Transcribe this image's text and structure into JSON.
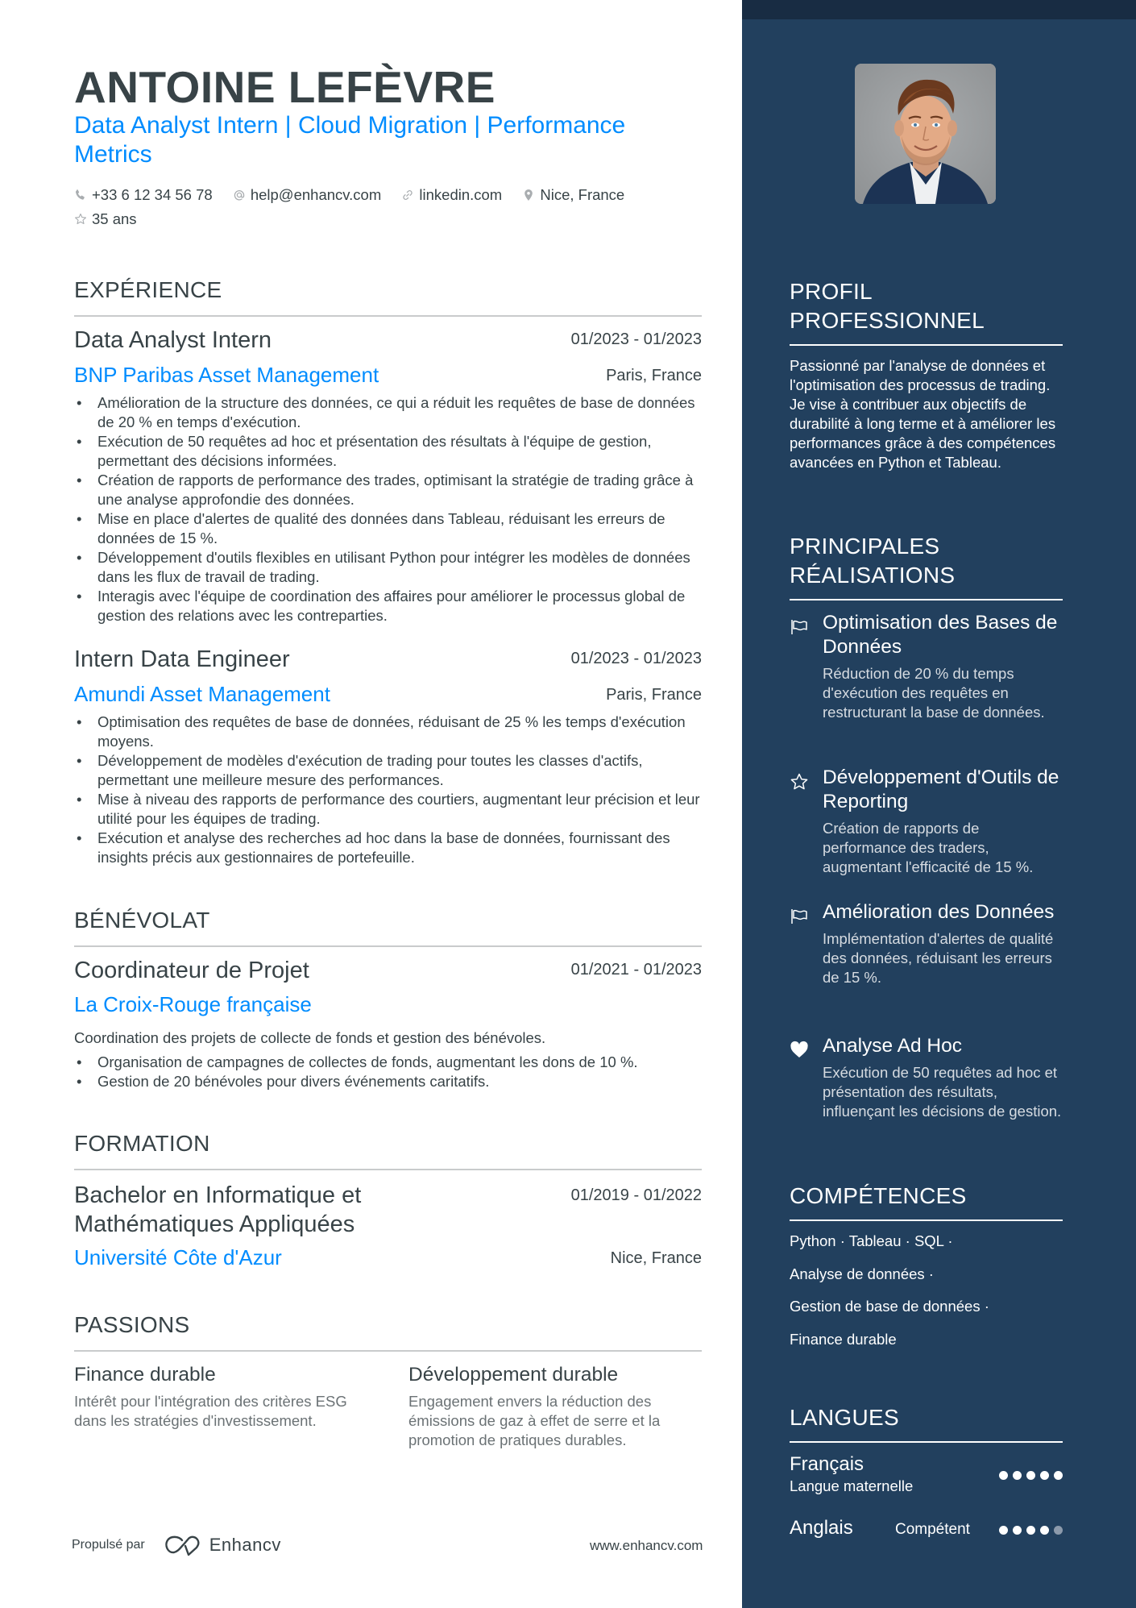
{
  "header": {
    "name": "ANTOINE LEFÈVRE",
    "subtitle": "Data Analyst Intern | Cloud Migration | Performance Metrics",
    "contacts": [
      {
        "icon": "phone-icon",
        "text": "+33 6 12 34 56 78"
      },
      {
        "icon": "at-icon",
        "text": "help@enhancv.com"
      },
      {
        "icon": "link-icon",
        "text": "linkedin.com"
      },
      {
        "icon": "location-pin-icon",
        "text": "Nice, France"
      },
      {
        "icon": "star-icon",
        "text": "35 ans"
      }
    ]
  },
  "experience": {
    "title": "EXPÉRIENCE",
    "entries": [
      {
        "role": "Data Analyst Intern",
        "dates": "01/2023 - 01/2023",
        "company": "BNP Paribas Asset Management",
        "location": "Paris, France",
        "bullets": [
          "Amélioration de la structure des données, ce qui a réduit les requêtes de base de données de 20 % en temps d'exécution.",
          "Exécution de 50 requêtes ad hoc et présentation des résultats à l'équipe de gestion, permettant des décisions informées.",
          "Création de rapports de performance des trades, optimisant la stratégie de trading grâce à une analyse approfondie des données.",
          "Mise en place d'alertes de qualité des données dans Tableau, réduisant les erreurs de données de 15 %.",
          "Développement d'outils flexibles en utilisant Python pour intégrer les modèles de données dans les flux de travail de trading.",
          "Interagis avec l'équipe de coordination des affaires pour améliorer le processus global de gestion des relations avec les contreparties."
        ]
      },
      {
        "role": "Intern Data Engineer",
        "dates": "01/2023 - 01/2023",
        "company": "Amundi Asset Management",
        "location": "Paris, France",
        "bullets": [
          "Optimisation des requêtes de base de données, réduisant de 25 % les temps d'exécution moyens.",
          "Développement de modèles d'exécution de trading pour toutes les classes d'actifs, permettant une meilleure mesure des performances.",
          "Mise à niveau des rapports de performance des courtiers, augmentant leur précision et leur utilité pour les équipes de trading.",
          "Exécution et analyse des recherches ad hoc dans la base de données, fournissant des insights précis aux gestionnaires de portefeuille."
        ]
      }
    ]
  },
  "volunteering": {
    "title": "BÉNÉVOLAT",
    "role": "Coordinateur de Projet",
    "dates": "01/2021 - 01/2023",
    "organization": "La Croix-Rouge française",
    "description": "Coordination des projets de collecte de fonds et gestion des bénévoles.",
    "bullets": [
      "Organisation de campagnes de collectes de fonds, augmentant les dons de 10 %.",
      "Gestion de 20 bénévoles pour divers événements caritatifs."
    ]
  },
  "education": {
    "title": "FORMATION",
    "degree": "Bachelor en Informatique et Mathématiques Appliquées",
    "dates": "01/2019 - 01/2022",
    "school": "Université Côte d'Azur",
    "location": "Nice, France"
  },
  "passions": {
    "title": "PASSIONS",
    "items": [
      {
        "title": "Finance durable",
        "description": "Intérêt pour l'intégration des critères ESG dans les stratégies d'investissement."
      },
      {
        "title": "Développement durable",
        "description": "Engagement envers la réduction des émissions de gaz à effet de serre et la promotion de pratiques durables."
      }
    ]
  },
  "footer": {
    "powered_by": "Propulsé par",
    "brand": "Enhancv",
    "website": "www.enhancv.com"
  },
  "sidebar": {
    "photo_alt": "Portrait of Antoine Lefèvre",
    "profile": {
      "title": "PROFIL PROFESSIONNEL",
      "text": "Passionné par l'analyse de données et l'optimisation des processus de trading. Je vise à contribuer aux objectifs de durabilité à long terme et à améliorer les performances grâce à des compétences avancées en Python et Tableau."
    },
    "achievements": {
      "title": "PRINCIPALES RÉALISATIONS",
      "items": [
        {
          "icon": "flag-icon",
          "title": "Optimisation des Bases de Données",
          "description": "Réduction de 20 % du temps d'exécution des requêtes en restructurant la base de données."
        },
        {
          "icon": "star-icon",
          "title": "Développement d'Outils de Reporting",
          "description": "Création de rapports de performance des traders, augmentant l'efficacité de 15 %."
        },
        {
          "icon": "flag-icon",
          "title": "Amélioration des Données",
          "description": "Implémentation d'alertes de qualité des données, réduisant les erreurs de 15 %."
        },
        {
          "icon": "heart-icon",
          "title": "Analyse Ad Hoc",
          "description": "Exécution de 50 requêtes ad hoc et présentation des résultats, influençant les décisions de gestion."
        }
      ]
    },
    "skills": {
      "title": "COMPÉTENCES",
      "lines": [
        "Python · Tableau · SQL ·",
        "Analyse de données ·",
        "Gestion de base de données ·",
        "Finance durable"
      ]
    },
    "languages": {
      "title": "LANGUES",
      "items": [
        {
          "name": "Français",
          "level": "Langue maternelle",
          "rating": 5,
          "max": 5
        },
        {
          "name": "Anglais",
          "level": "Compétent",
          "rating": 4,
          "max": 5
        }
      ]
    }
  }
}
